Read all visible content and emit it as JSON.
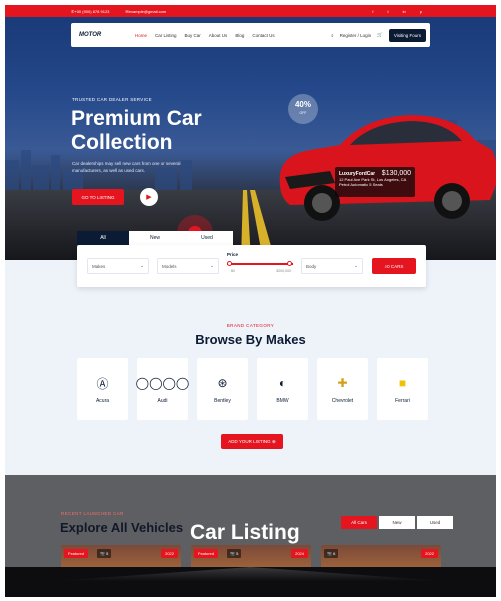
{
  "topbar": {
    "phone": "+00 (900) 678 9123",
    "email": "example@gmail.com",
    "social": [
      "f",
      "t",
      "in",
      "p"
    ]
  },
  "nav": {
    "logo": "MOTOR",
    "items": [
      "Home",
      "Car Listing",
      "Buy Car",
      "About Us",
      "Blog",
      "Contact Us"
    ],
    "active": "Home",
    "login": "Register / Login",
    "cart_count": "1",
    "cta": "Visiting Fours"
  },
  "hero": {
    "tagline": "TRUSTED CAR DEALER SERVICE",
    "title": "Premium Car Collection",
    "description": "Car dealerships may sell new cars from one or several manufacturers, as well as used cars.",
    "button": "GO TO LISTING",
    "badge_value": "40%",
    "badge_label": "OFF",
    "car_name": "LuxuryFordCar",
    "car_address": "12 Paul Ave Park St, Los Angeles, CA",
    "car_meta": "Petrol  Automatic  5 Seats",
    "car_price": "$130,000"
  },
  "filters": {
    "tabs": [
      "All",
      "New",
      "Used"
    ],
    "active_tab": "All",
    "make_placeholder": "Makes",
    "model_placeholder": "Models",
    "price_label": "Price",
    "price_min": "$0",
    "price_max": "$200,000",
    "body_placeholder": "Body",
    "search_button": "0 CARS"
  },
  "makes": {
    "subtitle": "BRAND CATEGORY",
    "title": "Browse By Makes",
    "brands": [
      "Acura",
      "Audi",
      "Bentley",
      "BMW",
      "Chevrolet",
      "Ferrari"
    ],
    "button": "ADD YOUR LISTING"
  },
  "listing": {
    "subtitle": "RECENT LAUNCHED CAR",
    "title": "Explore All Vehicles",
    "overlay": "Car Listing",
    "tabs": [
      "All Cars",
      "New",
      "Used"
    ],
    "active_tab": "All Cars",
    "cards": [
      {
        "badge": "Featured",
        "count": "5",
        "year": "2022"
      },
      {
        "badge": "Featured",
        "count": "5",
        "year": "2024"
      },
      {
        "badge": "",
        "count": "6",
        "year": "2022"
      }
    ]
  }
}
